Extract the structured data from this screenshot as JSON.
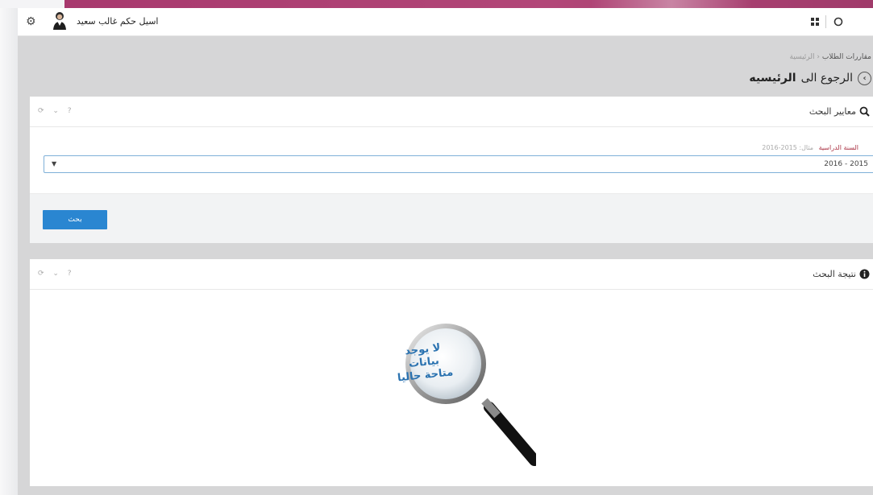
{
  "header": {
    "username": "اسيل حكم غالب سعيد",
    "icons": [
      "gear-icon",
      "avatar",
      "grid-icon",
      "refresh-icon"
    ]
  },
  "breadcrumb": {
    "home": "الرئيسية",
    "separator": "‹",
    "current": "مقاررات الطلاب"
  },
  "back_link": {
    "prefix": "الرجوع الى",
    "target": "الرئيسيه"
  },
  "search_panel": {
    "title": "معايير البحث",
    "tools": "⟳ ⌄ ?",
    "field_label": "السنة الدراسية",
    "field_hint": "مثال: 2015-2016",
    "selected_value": "2016 - 2015",
    "search_button": "بحث"
  },
  "results_panel": {
    "title": "نتيجة البحث",
    "tools": "⟳ ⌄ ?",
    "no_data_line1": "لا يوجد بيانات",
    "no_data_line2": "متاحة حاليا"
  },
  "colors": {
    "accent_blue": "#2a86d1",
    "top_strip": "#b24778",
    "no_data_text": "#2a72b0"
  }
}
